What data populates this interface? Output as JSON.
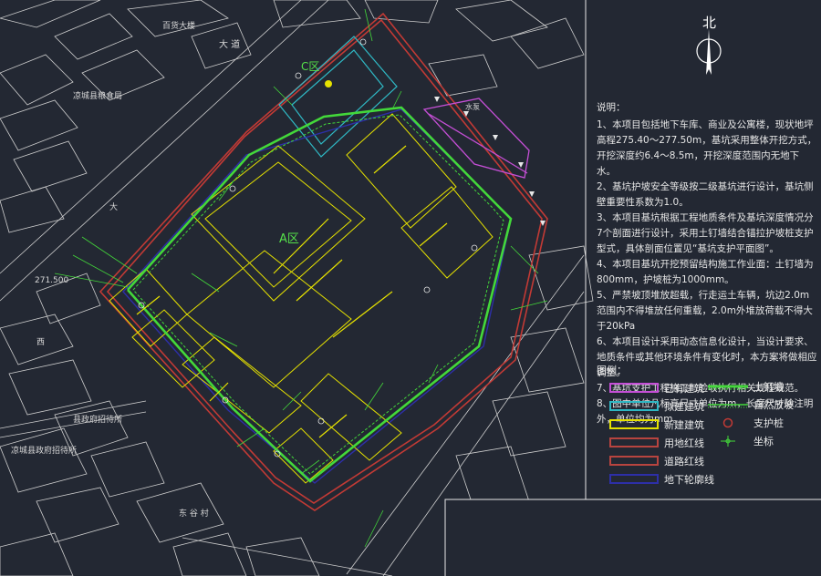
{
  "north": {
    "label": "北"
  },
  "zones": {
    "a": "A区",
    "c": "C区"
  },
  "elevation": "271.500",
  "notes": {
    "title": "说明：",
    "items": [
      "1、本项目包括地下车库、商业及公寓楼，现状地坪高程275.40～277.50m，基坑采用整体开挖方式，开挖深度约6.4～8.5m，开挖深度范围内无地下水。",
      "2、基坑护坡安全等级按二级基坑进行设计，基坑侧壁重要性系数为1.0。",
      "3、本项目基坑根据工程地质条件及基坑深度情况分7个剖面进行设计，采用土钉墙结合锚拉护坡桩支护型式，具体剖面位置见“基坑支护平面图”。",
      "4、本项目基坑开挖预留结构施工作业面：土钉墙为800mm，护坡桩为1000mm。",
      "5、严禁坡顶堆放超载，行走运土车辆，坑边2.0m范围内不得堆放任何重载，2.0m外堆放荷载不得大于20kPa",
      "6、本项目设计采用动态信息化设计，当设计要求、地质条件或其他环境条件有变化时，本方案将做相应调整。",
      "7、基坑支护工程施工与验收执行相关规程规范。",
      "8、图中单位凡标高尺寸单位为m，长度尺寸除注明外，单位均为mm。"
    ]
  },
  "legend": {
    "title": "图例：",
    "left": [
      {
        "label": "已有建筑",
        "color": "#c54fd6"
      },
      {
        "label": "拟建建筑",
        "color": "#2fb8c4"
      },
      {
        "label": "新建建筑",
        "color": "#e6e200"
      },
      {
        "label": "用地红线",
        "color": "#b8443f"
      },
      {
        "label": "道路红线",
        "color": "#b8443f"
      },
      {
        "label": "地下轮廓线",
        "color": "#2d2fa8"
      }
    ],
    "right": [
      {
        "label": "土钉墙"
      },
      {
        "label": "自然放坡"
      },
      {
        "label": "支护桩"
      },
      {
        "label": "坐标"
      }
    ]
  },
  "colors": {
    "background": "#232833",
    "site_boundary": "#c23a35",
    "support": "#43d83a",
    "building": "#e6e200",
    "existing": "#c54fd6",
    "planned": "#2fb8c4",
    "context": "#cfcfcf"
  }
}
